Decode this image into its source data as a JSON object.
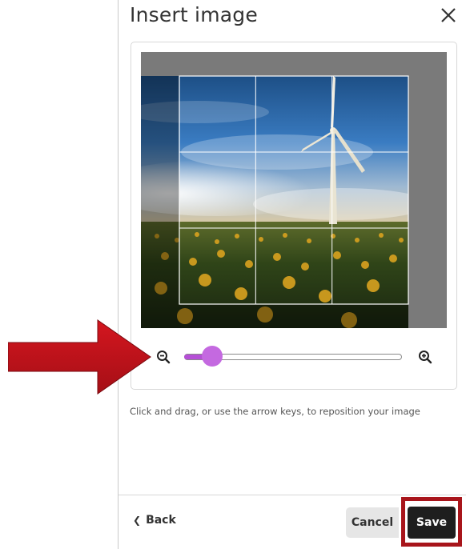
{
  "dialog": {
    "title": "Insert image",
    "close_icon": "close-icon"
  },
  "cropper": {
    "zoom_level_fraction": 0.13,
    "zoom_out_icon": "zoom-out-icon",
    "zoom_in_icon": "zoom-in-icon",
    "hint": "Click and drag, or use the arrow keys, to reposition your image"
  },
  "footer": {
    "back_label": "Back",
    "cancel_label": "Cancel",
    "save_label": "Save"
  },
  "annotation": {
    "arrow_color": "#c0121a",
    "highlight_color": "#a8151b"
  },
  "colors": {
    "accent": "#c469e0",
    "save_bg": "#1e1e1e"
  }
}
